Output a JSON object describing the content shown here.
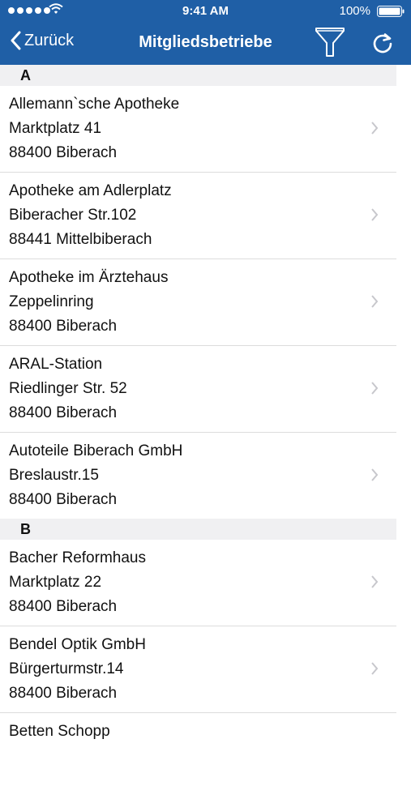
{
  "status_bar": {
    "time": "9:41 AM",
    "battery": "100%"
  },
  "nav": {
    "back_label": "Zurück",
    "title": "Mitgliedsbetriebe",
    "filter_icon": "filter-icon",
    "refresh_icon": "refresh-icon"
  },
  "sections": [
    {
      "letter": "A",
      "items": [
        {
          "name": "Allemann`sche Apotheke",
          "street": "Marktplatz 41",
          "city": "88400 Biberach"
        },
        {
          "name": "Apotheke am Adlerplatz",
          "street": "Biberacher Str.102",
          "city": "88441 Mittelbiberach"
        },
        {
          "name": "Apotheke im Ärztehaus",
          "street": "Zeppelinring",
          "city": "88400 Biberach"
        },
        {
          "name": "ARAL-Station",
          "street": "Riedlinger Str. 52",
          "city": "88400 Biberach"
        },
        {
          "name": "Autoteile Biberach GmbH",
          "street": "Breslaustr.15",
          "city": "88400 Biberach"
        }
      ]
    },
    {
      "letter": "B",
      "items": [
        {
          "name": "Bacher Reformhaus",
          "street": "Marktplatz 22",
          "city": "88400 Biberach"
        },
        {
          "name": "Bendel Optik  GmbH",
          "street": "Bürgerturmstr.14",
          "city": "88400 Biberach"
        },
        {
          "name": "Betten Schopp",
          "street": "",
          "city": ""
        }
      ]
    }
  ],
  "colors": {
    "accent": "#1f5fa6",
    "section_bg": "#f0f0f2",
    "separator": "#dcdcdc",
    "chevron": "#c7c7cc"
  }
}
